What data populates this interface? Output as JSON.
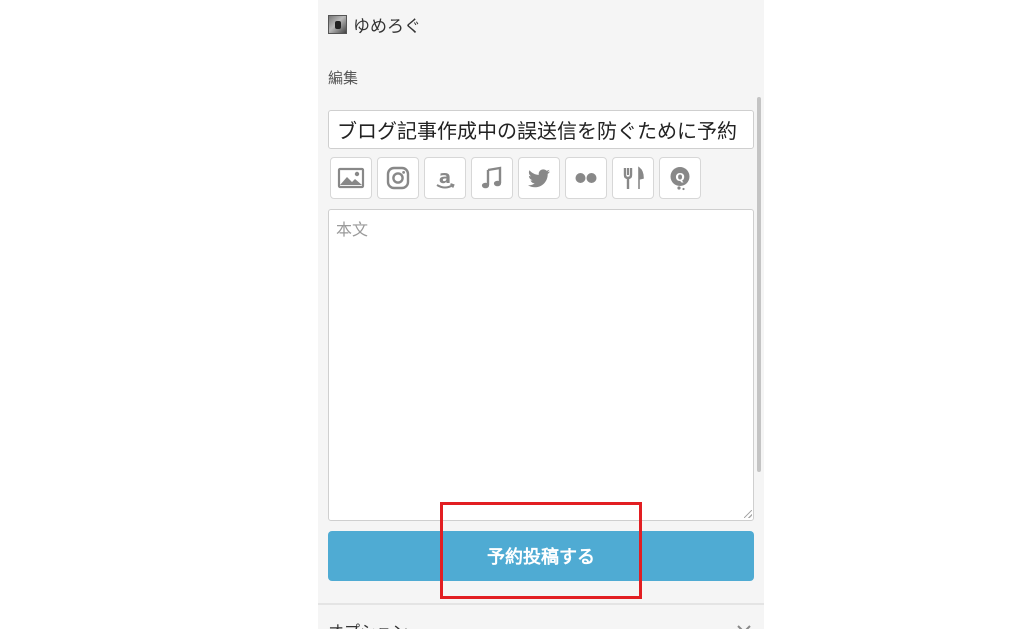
{
  "header": {
    "blog_name": "ゆめろぐ",
    "avatar_icon": "blog-avatar-icon"
  },
  "editor": {
    "section_label": "編集",
    "title_value": "ブログ記事作成中の誤送信を防ぐために予約",
    "body_placeholder": "本文",
    "body_value": ""
  },
  "toolbar": {
    "buttons": [
      {
        "icon": "image-icon"
      },
      {
        "icon": "instagram-icon"
      },
      {
        "icon": "amazon-icon"
      },
      {
        "icon": "music-icon"
      },
      {
        "icon": "twitter-icon"
      },
      {
        "icon": "flickr-icon"
      },
      {
        "icon": "restaurant-icon"
      },
      {
        "icon": "question-bubble-icon"
      }
    ]
  },
  "actions": {
    "submit_label": "予約投稿する"
  },
  "options": {
    "label": "オプション"
  },
  "colors": {
    "accent": "#4fabd3",
    "highlight": "#e21e22",
    "icon": "#888888",
    "panel_bg": "#f5f5f5"
  }
}
